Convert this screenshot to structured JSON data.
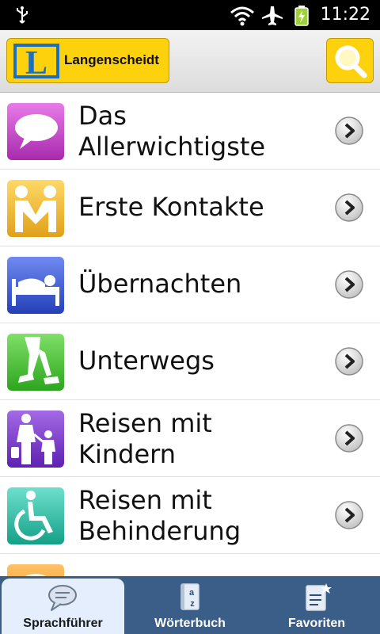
{
  "status_bar": {
    "time": "11:22"
  },
  "header": {
    "logo_letter": "L",
    "logo_text": "Langenscheidt"
  },
  "categories": [
    {
      "label_line1": "Das",
      "label_line2": "Allerwichtigste",
      "icon": "speech-bubble-icon",
      "color": "#c23fc8"
    },
    {
      "label_line1": "Erste Kontakte",
      "label_line2": "",
      "icon": "handshake-icon",
      "color": "#f2b51e"
    },
    {
      "label_line1": "Übernachten",
      "label_line2": "",
      "icon": "bed-icon",
      "color": "#3f5fd8"
    },
    {
      "label_line1": "Unterwegs",
      "label_line2": "",
      "icon": "walking-legs-icon",
      "color": "#3fbd36"
    },
    {
      "label_line1": "Reisen mit",
      "label_line2": "Kindern",
      "icon": "parent-child-icon",
      "color": "#7a3fcf"
    },
    {
      "label_line1": "Reisen mit",
      "label_line2": "Behinderung",
      "icon": "wheelchair-icon",
      "color": "#22b6a0"
    },
    {
      "label_line1": "",
      "label_line2": "",
      "icon": "partial-category-icon",
      "color": "#f29b1e"
    }
  ],
  "tabs": [
    {
      "label": "Sprachführer",
      "icon": "chat-bubbles-icon",
      "active": true
    },
    {
      "label": "Wörterbuch",
      "icon": "dictionary-az-icon",
      "active": false
    },
    {
      "label": "Favoriten",
      "icon": "favorites-star-icon",
      "active": false
    }
  ],
  "colors": {
    "brand_yellow": "#fdd20d",
    "logo_blue": "#1b6fc2",
    "tabbar": "#3a5e87",
    "active_tab": "#e4eefc"
  }
}
